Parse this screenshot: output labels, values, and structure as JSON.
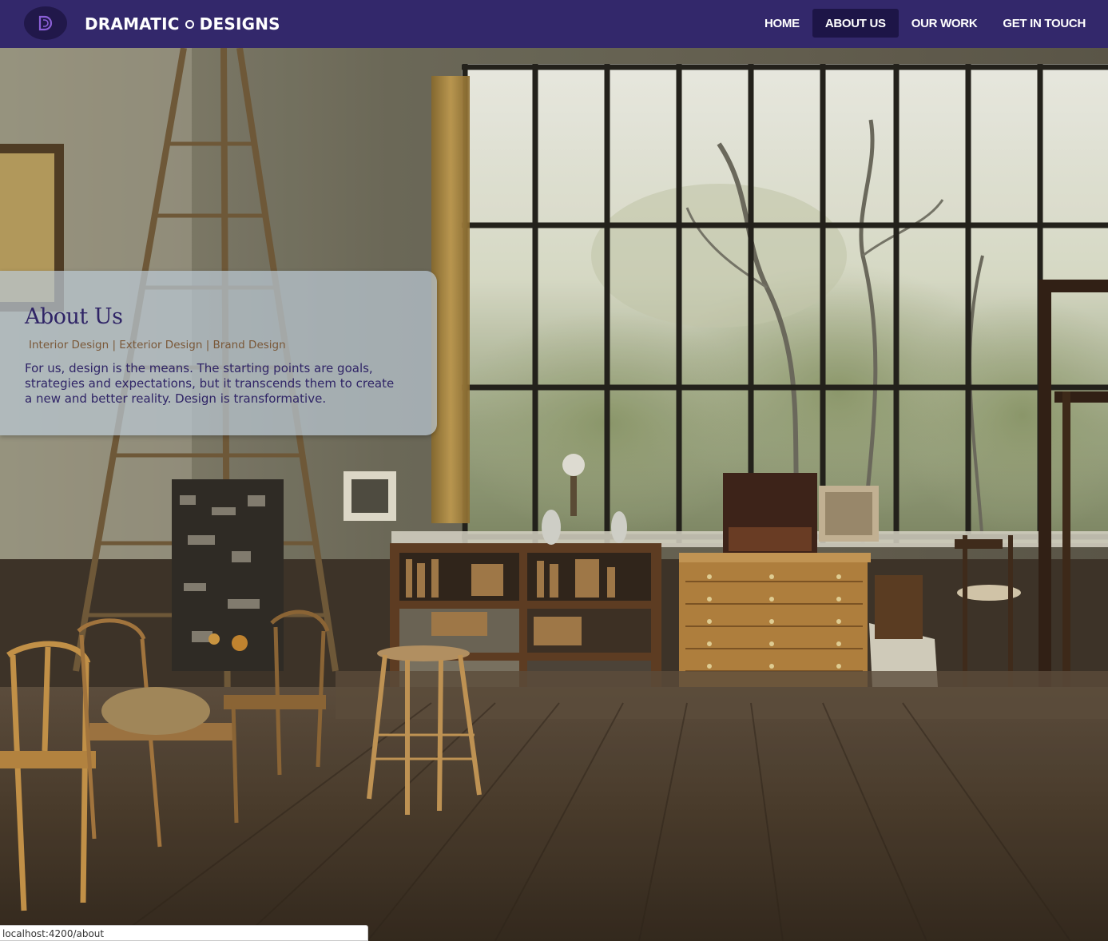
{
  "brand": {
    "logo_letter": "D",
    "name_left": "DRAMATIC",
    "name_right": "DESIGNS"
  },
  "nav": {
    "items": [
      {
        "label": "HOME",
        "active": false
      },
      {
        "label": "ABOUT US",
        "active": true
      },
      {
        "label": "OUR WORK",
        "active": false
      },
      {
        "label": "GET IN TOUCH",
        "active": false
      }
    ]
  },
  "about": {
    "title": "About Us",
    "tags": "Interior Design | Exterior Design | Brand Design",
    "body": "For us, design is the means. The starting points are goals, strategies and expectations, but it transcends them to create a new and better reality. Design is transformative."
  },
  "status": {
    "url": "localhost:4200/about"
  },
  "colors": {
    "navbar": "#33286b",
    "nav_active": "#1d1547",
    "accent_text": "#2f2466",
    "tag_text": "#7a5838"
  }
}
